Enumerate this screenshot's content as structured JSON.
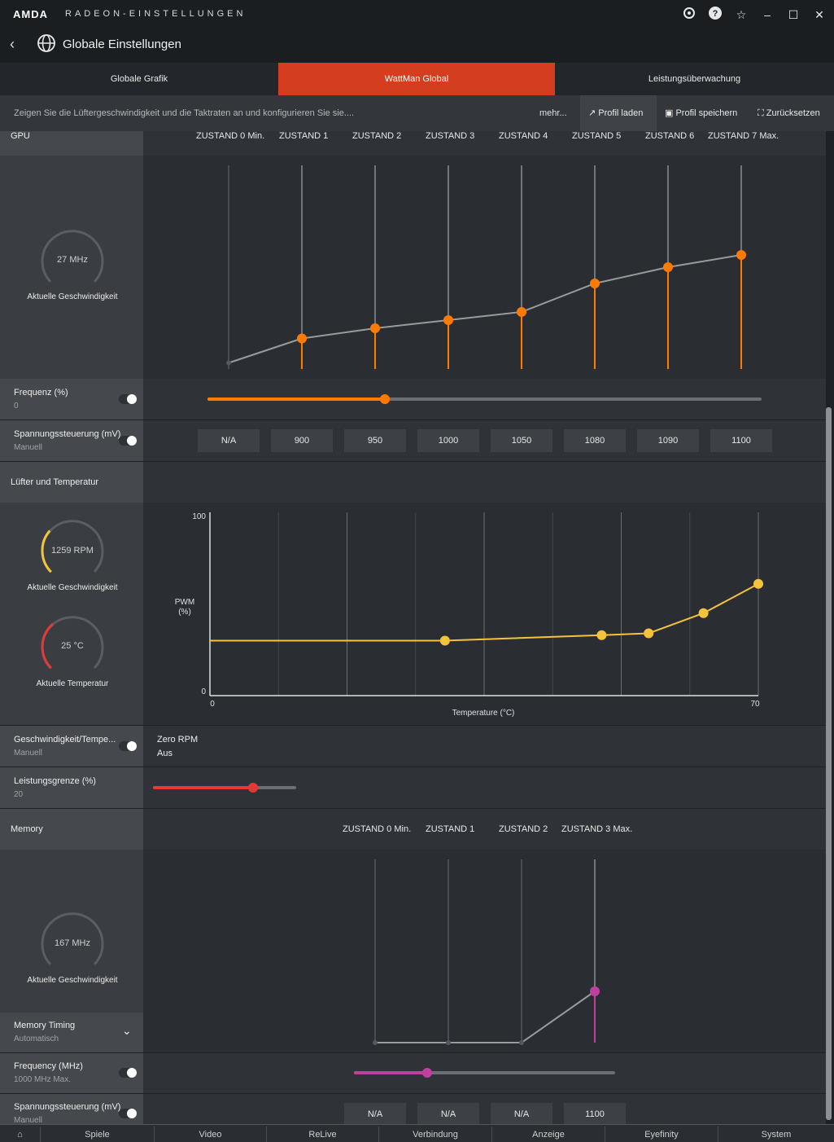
{
  "titlebar": {
    "brand": "AMDA",
    "app_title": "RADEON-EINSTELLUNGEN",
    "icons": [
      "refresh-icon",
      "help-icon",
      "star-icon",
      "minimize-icon",
      "maximize-icon",
      "close-icon"
    ]
  },
  "header": {
    "title": "Globale Einstellungen"
  },
  "tabs": [
    {
      "label": "Globale Grafik",
      "active": false
    },
    {
      "label": "WattMan Global",
      "active": true
    },
    {
      "label": "Leistungsüberwachung",
      "active": false
    }
  ],
  "infobar": {
    "text": "Zeigen Sie die Lüftergeschwindigkeit und die Taktraten an und konfigurieren Sie sie....",
    "more": "mehr...",
    "load_profile": "Profil laden",
    "save_profile": "Profil speichern",
    "reset": "Zurücksetzen"
  },
  "gpu": {
    "section_label": "GPU",
    "states": [
      "ZUSTAND 0 Min.",
      "ZUSTAND 1",
      "ZUSTAND 2",
      "ZUSTAND 3",
      "ZUSTAND 4",
      "ZUSTAND 5",
      "ZUSTAND 6",
      "ZUSTAND 7 Max."
    ],
    "gauge_value": "27 MHz",
    "gauge_label": "Aktuelle Geschwindigkeit",
    "curve_levels": [
      0.03,
      0.15,
      0.2,
      0.24,
      0.28,
      0.42,
      0.5,
      0.56
    ],
    "frequency_label": "Frequenz (%)",
    "frequency_value": "0",
    "frequency_slider": 0.32,
    "voltage_label": "Spannungssteuerung (mV)",
    "voltage_mode": "Manuell",
    "voltages": [
      "N/A",
      "900",
      "950",
      "1000",
      "1050",
      "1080",
      "1090",
      "1100"
    ]
  },
  "fan": {
    "section_label": "Lüfter und Temperatur",
    "rpm_value": "1259 RPM",
    "rpm_label": "Aktuelle Geschwindigkeit",
    "rpm_level": 0.32,
    "temp_value": "25 °C",
    "temp_label": "Aktuelle Temperatur",
    "temp_level": 0.35,
    "chart_data": {
      "type": "line",
      "xlabel": "Temperature (°C)",
      "ylabel": "PWM\n(%)",
      "xlim": [
        0,
        70
      ],
      "ylim": [
        0,
        100
      ],
      "x_ticks": [
        "0",
        "70"
      ],
      "y_ticks": [
        "0",
        "100"
      ],
      "x": [
        0,
        30,
        50,
        56,
        63,
        70
      ],
      "y": [
        30,
        30,
        33,
        34,
        45,
        61
      ]
    },
    "speed_temp_label": "Geschwindigkeit/Tempe...",
    "speed_temp_mode": "Manuell",
    "zero_rpm_label": "Zero RPM",
    "zero_rpm_value": "Aus",
    "power_limit_label": "Leistungsgrenze (%)",
    "power_limit_value": "20",
    "power_limit_slider": 0.7
  },
  "memory": {
    "section_label": "Memory",
    "states": [
      "ZUSTAND 0 Min.",
      "ZUSTAND 1",
      "ZUSTAND 2",
      "ZUSTAND 3 Max."
    ],
    "gauge_value": "167 MHz",
    "gauge_label": "Aktuelle Geschwindigkeit",
    "timing_label": "Memory Timing",
    "timing_value": "Automatisch",
    "curve_levels": [
      0.0,
      0.0,
      0.0,
      0.28
    ],
    "frequency_label": "Frequency (MHz)",
    "frequency_sub": "1000 MHz Max.",
    "frequency_slider": 0.28,
    "voltage_label": "Spannungssteuerung (mV)",
    "voltage_mode": "Manuell",
    "voltages": [
      "N/A",
      "N/A",
      "N/A",
      "1100"
    ]
  },
  "bottom_nav": [
    "Spiele",
    "Video",
    "ReLive",
    "Verbindung",
    "Anzeige",
    "Eyefinity",
    "System"
  ],
  "colors": {
    "accent": "#d53d1f",
    "gpu_curve": "#ff7a00",
    "fan_curve": "#f5c23b",
    "temp_arc": "#e53935",
    "memory_curve": "#c040a0"
  }
}
